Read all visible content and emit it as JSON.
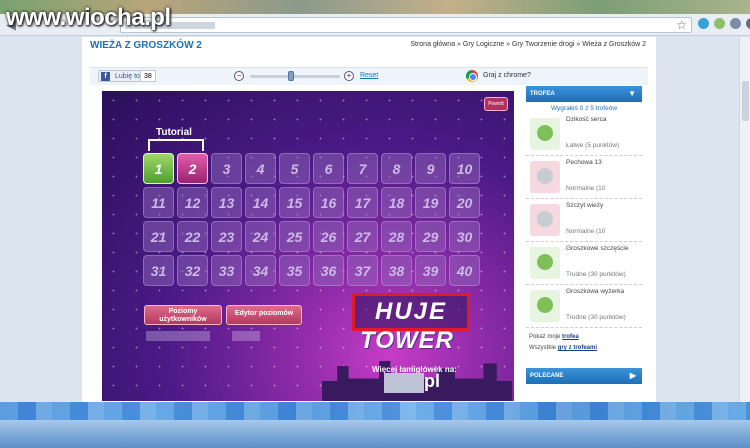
{
  "watermark": "www.wiocha.pl",
  "page": {
    "title": "WIEŻA Z GROSZKÓW 2",
    "breadcrumb": "Strona główna » Gry Logiczne » Gry Tworzenie drogi » Wieża z Groszków 2"
  },
  "toolbar": {
    "like_label": "Lubię to!",
    "like_count": "38",
    "zoom_level": 0.45,
    "reset_label": "Reset",
    "chrome_label": "Graj z chrome?"
  },
  "game": {
    "back_label": "Powrót",
    "tutorial_label": "Tutorial",
    "levels": [
      "1",
      "2",
      "3",
      "4",
      "5",
      "6",
      "7",
      "8",
      "9",
      "10",
      "11",
      "12",
      "13",
      "14",
      "15",
      "16",
      "17",
      "18",
      "19",
      "20",
      "21",
      "22",
      "23",
      "24",
      "25",
      "26",
      "27",
      "28",
      "29",
      "30",
      "31",
      "32",
      "33",
      "34",
      "35",
      "36",
      "37",
      "38",
      "39",
      "40"
    ],
    "user_levels_button": "Poziomy użytkowników",
    "editor_button": "Edytor poziomów",
    "logo_line1": "HUJE",
    "logo_line2": "TOWER",
    "more_games": "Więcej łamigłówek na:",
    "more_games_domain": "pl"
  },
  "sidebar": {
    "trophies_header": "TROFEA",
    "summary": "Wygrałeś 0 z 5 trofeów",
    "trophies": [
      {
        "name": "Dzikość serca",
        "level": "Łatwe (5 punktów)"
      },
      {
        "name": "Pechowa 13",
        "level": "Normalne (10"
      },
      {
        "name": "Szczyt wieży",
        "level": "Normalne (10"
      },
      {
        "name": "Groszkowe szczęście",
        "level": "Trudne (30 punktów)"
      },
      {
        "name": "Groszkowa wyżerka",
        "level": "Trudne (30 punktów)"
      }
    ],
    "show_my_trophies_prefix": "Pokaż moje",
    "show_my_trophies_link": "trofea",
    "all_games_prefix": "Wszystkie",
    "all_games_link": "gry z trofeami",
    "recommended_header": "POLECANE"
  },
  "colors": {
    "accent": "#1d72b8",
    "level_complete": "#4e9f2c",
    "level_current": "#9b2270"
  }
}
